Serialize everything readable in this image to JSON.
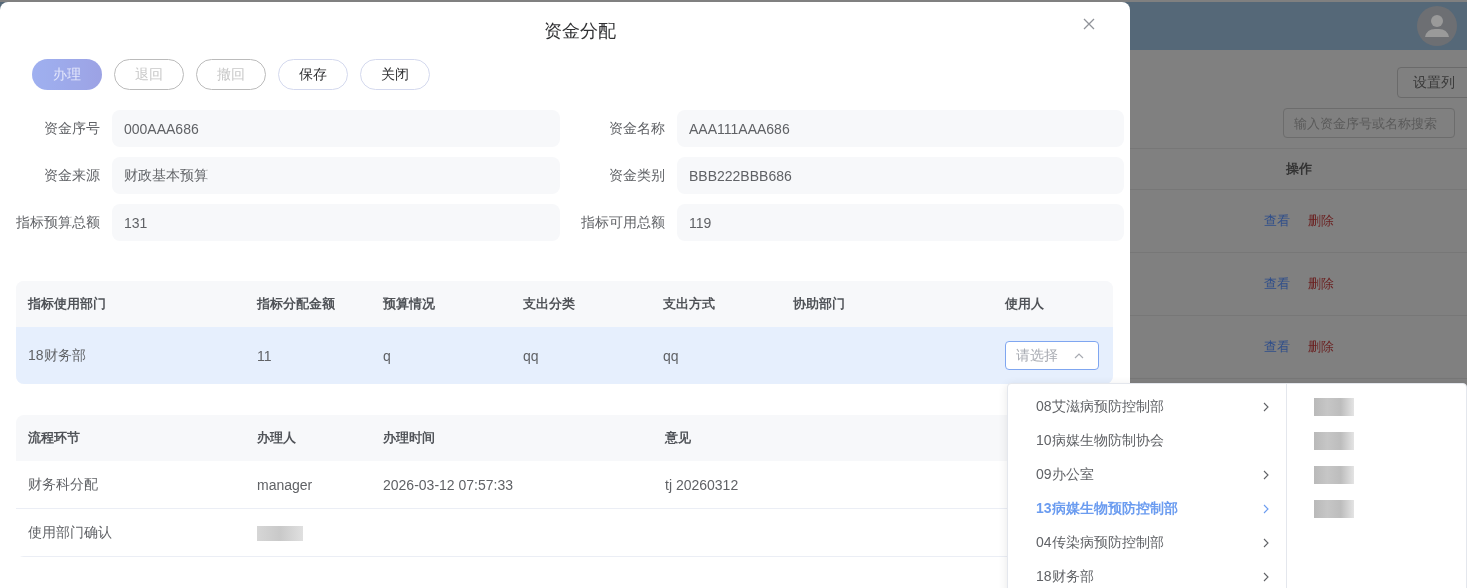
{
  "background_page": {
    "toolbar_button": "设置列",
    "search": {
      "placeholder": "输入资金序号或名称搜索"
    },
    "table": {
      "columns": [
        "操作"
      ],
      "rows": [
        {
          "actions": [
            {
              "label": "查看",
              "kind": "view"
            },
            {
              "label": "删除",
              "kind": "delete"
            }
          ]
        },
        {
          "actions": [
            {
              "label": "查看",
              "kind": "view"
            },
            {
              "label": "删除",
              "kind": "delete"
            }
          ]
        },
        {
          "actions": [
            {
              "label": "查看",
              "kind": "view"
            },
            {
              "label": "删除",
              "kind": "delete"
            }
          ]
        }
      ]
    }
  },
  "dialog": {
    "title": "资金分配",
    "buttons": [
      {
        "label": "办理",
        "kind": "primary",
        "disabled": true
      },
      {
        "label": "退回",
        "kind": "default",
        "disabled": true
      },
      {
        "label": "撤回",
        "kind": "default",
        "disabled": true
      },
      {
        "label": "保存",
        "kind": "default",
        "disabled": false
      },
      {
        "label": "关闭",
        "kind": "default",
        "disabled": false
      }
    ],
    "fields": [
      {
        "label": "资金序号",
        "value": "000AAA686"
      },
      {
        "label": "资金名称",
        "value": "AAA111AAA686"
      },
      {
        "label": "资金来源",
        "value": "财政基本预算"
      },
      {
        "label": "资金类别",
        "value": "BBB222BBB686"
      },
      {
        "label": "指标预算总额",
        "value": "131"
      },
      {
        "label": "指标可用总额",
        "value": "119"
      }
    ],
    "allocation_table": {
      "columns": [
        "指标使用部门",
        "指标分配金额",
        "预算情况",
        "支出分类",
        "支出方式",
        "协助部门",
        "使用人"
      ],
      "rows": [
        {
          "selected": true,
          "cells": [
            "18财务部",
            "11",
            "q",
            "qq",
            "qq",
            ""
          ],
          "user_select": {
            "placeholder": "请选择",
            "expanded": true
          }
        }
      ]
    },
    "flow_table": {
      "columns": [
        "流程环节",
        "办理人",
        "办理时间",
        "意见"
      ],
      "rows": [
        {
          "cells": [
            {
              "kind": "text",
              "text": "财务科分配"
            },
            {
              "kind": "text",
              "text": "manager"
            },
            {
              "kind": "text",
              "text": "2026-03-12 07:57:33"
            },
            {
              "kind": "text",
              "text": "tj 20260312"
            }
          ]
        },
        {
          "cells": [
            {
              "kind": "text",
              "text": "使用部门确认"
            },
            {
              "kind": "redacted"
            }
          ]
        }
      ]
    }
  },
  "cascader": {
    "departments": [
      {
        "label": "08艾滋病预防控制部",
        "has_children": true,
        "selected": false
      },
      {
        "label": "10病媒生物防制协会",
        "has_children": false,
        "selected": false
      },
      {
        "label": "09办公室",
        "has_children": true,
        "selected": false
      },
      {
        "label": "13病媒生物预防控制部",
        "has_children": true,
        "selected": true
      },
      {
        "label": "04传染病预防控制部",
        "has_children": true,
        "selected": false
      },
      {
        "label": "18财务部",
        "has_children": true,
        "selected": false
      }
    ],
    "people": [
      {
        "kind": "redacted"
      },
      {
        "kind": "redacted"
      },
      {
        "kind": "redacted"
      },
      {
        "kind": "redacted"
      }
    ]
  }
}
